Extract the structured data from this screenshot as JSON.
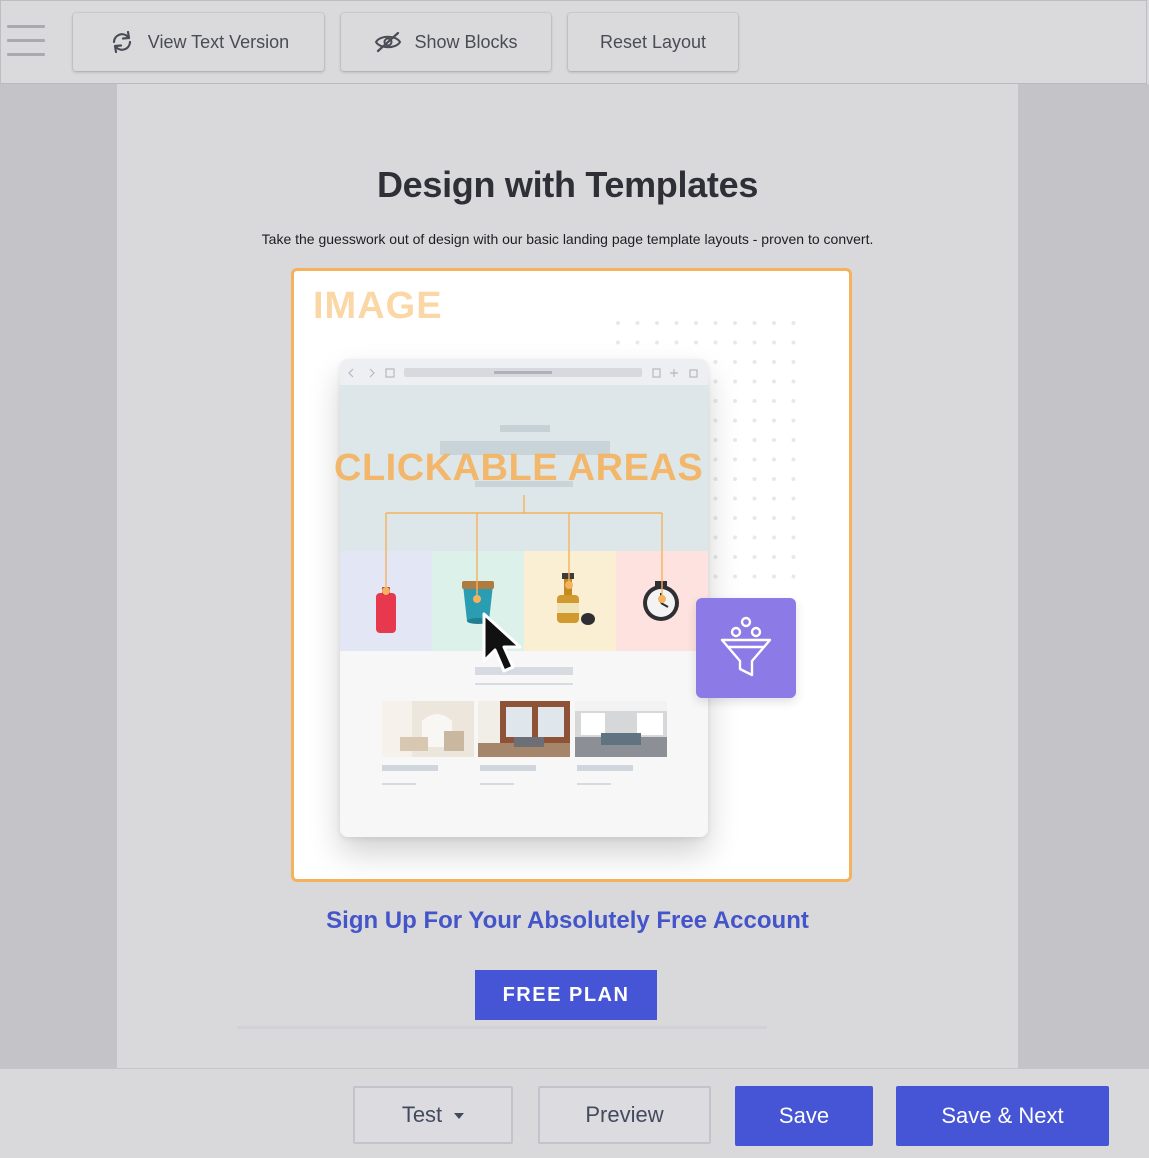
{
  "toolbar": {
    "menu_icon": "hamburger-icon",
    "view_text_label": "View Text Version",
    "view_text_icon": "refresh-icon",
    "show_blocks_label": "Show Blocks",
    "show_blocks_icon": "eye-slash-icon",
    "reset_layout_label": "Reset Layout"
  },
  "content": {
    "title": "Design with Templates",
    "subtitle": "Take the guesswork out of design with our basic landing page template layouts - proven to convert.",
    "image_block_label": "IMAGE",
    "clickable_areas_label": "CLICKABLE AREAS",
    "signup_text": "Sign Up For Your Absolutely Free Account",
    "cta_label": "FREE PLAN"
  },
  "footer": {
    "test_label": "Test",
    "preview_label": "Preview",
    "save_label": "Save",
    "save_next_label": "Save & Next"
  },
  "colors": {
    "accent": "#4555d6",
    "image_border": "#f5b25e",
    "funnel_tile": "#8c7ae6",
    "signup_text": "#4455c9"
  }
}
